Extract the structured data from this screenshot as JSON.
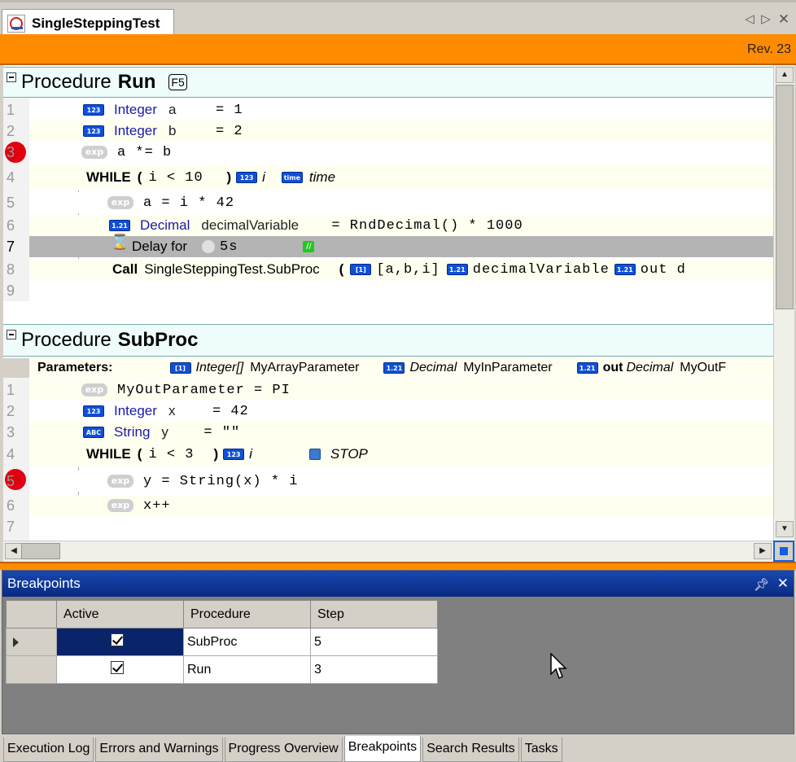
{
  "document_tab": {
    "label": "SingleSteppingTest"
  },
  "revision": "Rev. 23",
  "proc_run": {
    "keyword": "Procedure",
    "name": "Run",
    "shortcut": "F5",
    "lines": [
      {
        "n": "1",
        "type": "Integer",
        "var": "a",
        "op": "= 1",
        "icon": "123"
      },
      {
        "n": "2",
        "type": "Integer",
        "var": "b",
        "op": "= 2",
        "icon": "123"
      },
      {
        "n": "3",
        "expr": "a *= b"
      },
      {
        "n": "4",
        "kw": "WHILE",
        "paren_open": "(",
        "cond": "i < 10",
        "paren_close": ")",
        "var1": "i",
        "var2": "time"
      },
      {
        "n": "5",
        "expr": "a = i * 42"
      },
      {
        "n": "6",
        "type": "Decimal",
        "var": "decimalVariable",
        "op": "= RndDecimal() * 1000"
      },
      {
        "n": "7",
        "text": "Delay for",
        "value": "5s",
        "green": "//"
      },
      {
        "n": "8",
        "kw": "Call",
        "target": "SingleSteppingTest.SubProc",
        "paren": "(",
        "arg1": "[a,b,i]",
        "arg2": "decimalVariable",
        "arg3": "out d"
      },
      {
        "n": "9"
      }
    ]
  },
  "proc_sub": {
    "keyword": "Procedure",
    "name": "SubProc",
    "params_label": "Parameters:",
    "params": [
      {
        "type": "Integer[]",
        "name": "MyArrayParameter"
      },
      {
        "type": "Decimal",
        "name": "MyInParameter"
      },
      {
        "mod": "out",
        "type": "Decimal",
        "name": "MyOutF"
      }
    ],
    "lines": [
      {
        "n": "1",
        "expr": "MyOutParameter = PI"
      },
      {
        "n": "2",
        "type": "Integer",
        "var": "x",
        "op": "= 42"
      },
      {
        "n": "3",
        "type": "String",
        "var": "y",
        "op": "= \"\""
      },
      {
        "n": "4",
        "kw": "WHILE",
        "paren_open": "(",
        "cond": "i < 3",
        "paren_close": ")",
        "var1": "i",
        "stop": "STOP"
      },
      {
        "n": "5",
        "expr": "y = String(x) * i"
      },
      {
        "n": "6",
        "expr": "x++"
      },
      {
        "n": "7"
      }
    ]
  },
  "breakpoints": {
    "title": "Breakpoints",
    "columns": [
      "Active",
      "Procedure",
      "Step"
    ],
    "rows": [
      {
        "procedure": "SubProc",
        "step": "5"
      },
      {
        "procedure": "Run",
        "step": "3"
      }
    ]
  },
  "bottom_tabs": [
    "Execution Log",
    "Errors and Warnings",
    "Progress Overview",
    "Breakpoints",
    "Search Results",
    "Tasks"
  ],
  "icons": {
    "integer": "123",
    "exp": "exp",
    "decimal": "1.21",
    "string": "ABC",
    "array": "[1]",
    "time": "time"
  },
  "colors": {
    "accent": "#ff8c00",
    "breakpoint": "#e00010",
    "panel_title": "#0a2a80"
  }
}
